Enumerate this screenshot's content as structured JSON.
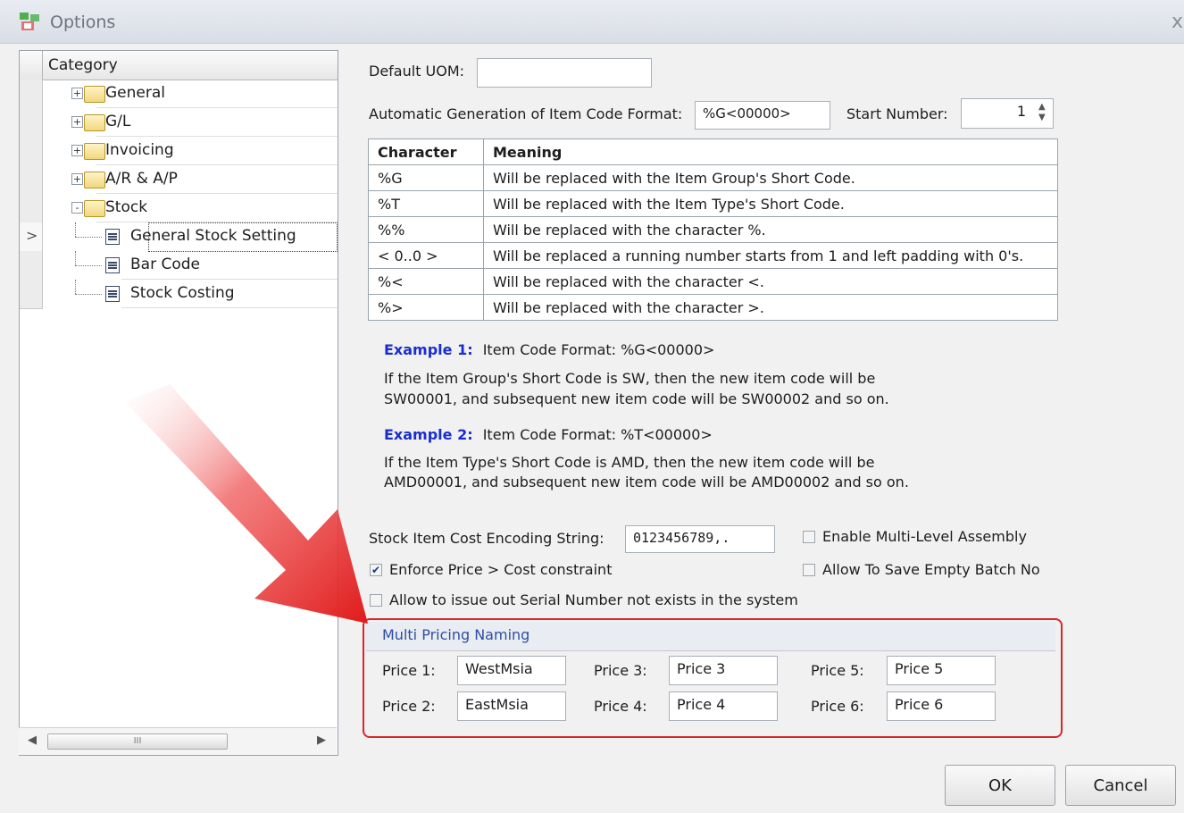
{
  "window": {
    "title": "Options",
    "close_glyph": "x"
  },
  "tree": {
    "header": "Category",
    "items": [
      {
        "label": "General",
        "expander": "+"
      },
      {
        "label": "G/L",
        "expander": "+"
      },
      {
        "label": "Invoicing",
        "expander": "+"
      },
      {
        "label": "A/R & A/P",
        "expander": "+"
      },
      {
        "label": "Stock",
        "expander": "-"
      },
      {
        "label": "General Stock Setting",
        "selected": true
      },
      {
        "label": "Bar Code"
      },
      {
        "label": "Stock Costing"
      }
    ],
    "row_indicator": ">",
    "scroll_thumb": "III"
  },
  "form": {
    "default_uom_label": "Default UOM:",
    "default_uom_value": "",
    "auto_gen_label": "Automatic Generation of Item Code Format:",
    "auto_gen_value": "%G<00000>",
    "start_number_label": "Start Number:",
    "start_number_value": "1",
    "table": {
      "headers": [
        "Character",
        "Meaning"
      ],
      "rows": [
        [
          "%G",
          "Will be replaced with the Item Group's Short Code."
        ],
        [
          "%T",
          "Will be replaced with the Item Type's Short Code."
        ],
        [
          "%%",
          "Will be replaced with the character %."
        ],
        [
          "< 0..0 >",
          "Will be replaced a running number starts from 1 and left padding with 0's."
        ],
        [
          "%<",
          "Will be replaced with the character <."
        ],
        [
          "%>",
          "Will be replaced with the character >."
        ]
      ]
    },
    "example1": {
      "title": "Example 1:",
      "format": "Item Code Format: %G<00000>",
      "line1": "If the Item Group's Short Code is SW, then the new item code will be",
      "line2": "SW00001, and subsequent new item code will be SW00002 and so on."
    },
    "example2": {
      "title": "Example 2:",
      "format": "Item Code Format: %T<00000>",
      "line1": "If the Item Type's Short Code is AMD, then the new item code will be",
      "line2": "AMD00001, and subsequent new item code will be AMD00002 and so on."
    },
    "cost_encoding_label": "Stock Item Cost Encoding String:",
    "cost_encoding_value": "0123456789,.",
    "enable_multi_level": {
      "label": "Enable Multi-Level Assembly",
      "checked": false
    },
    "enforce_price": {
      "label": "Enforce Price > Cost constraint",
      "checked": true
    },
    "allow_empty_batch": {
      "label": "Allow To Save Empty Batch No",
      "checked": false
    },
    "allow_serial": {
      "label": "Allow to issue out Serial Number not exists in the system",
      "checked": false
    },
    "multi_pricing": {
      "title": "Multi Pricing Naming",
      "prices": [
        {
          "label": "Price 1:",
          "value": "WestMsia"
        },
        {
          "label": "Price 2:",
          "value": "EastMsia"
        },
        {
          "label": "Price 3:",
          "value": "Price 3"
        },
        {
          "label": "Price 4:",
          "value": "Price 4"
        },
        {
          "label": "Price 5:",
          "value": "Price 5"
        },
        {
          "label": "Price 6:",
          "value": "Price 6"
        }
      ]
    }
  },
  "buttons": {
    "ok": "OK",
    "cancel": "Cancel"
  },
  "colors": {
    "accent_red": "#d8262b",
    "example_blue": "#1a2dd0",
    "group_title": "#2d4ea2"
  }
}
